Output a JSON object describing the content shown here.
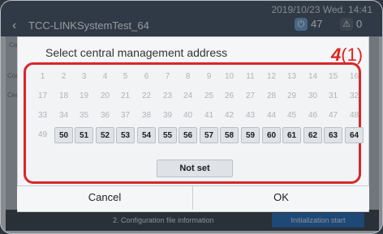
{
  "app": {
    "datetime": "2019/10/23 Wed. 14:41",
    "title": "TCC-LINKSystemTest_64",
    "power_count": "47",
    "alarm_count": "0"
  },
  "background": {
    "tab_cancel": "Cance",
    "side_a": "Conn",
    "side_b": "Cent addr",
    "config_label": "2. Configuration file information",
    "init_button": "Initialization start"
  },
  "dialog": {
    "title": "Select central management address",
    "marker_number": "4",
    "marker_paren": "(1)",
    "addresses_disabled": [
      "1",
      "2",
      "3",
      "4",
      "5",
      "6",
      "7",
      "8",
      "9",
      "10",
      "11",
      "12",
      "13",
      "14",
      "15",
      "16",
      "17",
      "18",
      "19",
      "20",
      "21",
      "22",
      "23",
      "24",
      "25",
      "26",
      "27",
      "28",
      "29",
      "30",
      "31",
      "32",
      "33",
      "34",
      "35",
      "36",
      "37",
      "38",
      "39",
      "40",
      "41",
      "42",
      "43",
      "44",
      "45",
      "46",
      "47",
      "48",
      "49"
    ],
    "addresses_enabled": [
      "50",
      "51",
      "52",
      "53",
      "54",
      "55",
      "56",
      "57",
      "58",
      "59",
      "60",
      "61",
      "62",
      "63",
      "64"
    ],
    "not_set_label": "Not set",
    "cancel_label": "Cancel",
    "ok_label": "OK"
  },
  "colors": {
    "marker_red": "#e2231a",
    "highlight_border": "#d9262b",
    "topbar": "#4b5a6c"
  },
  "icons": {
    "back": "chevron-left-icon",
    "power": "power-icon",
    "alarm": "warning-icon"
  }
}
